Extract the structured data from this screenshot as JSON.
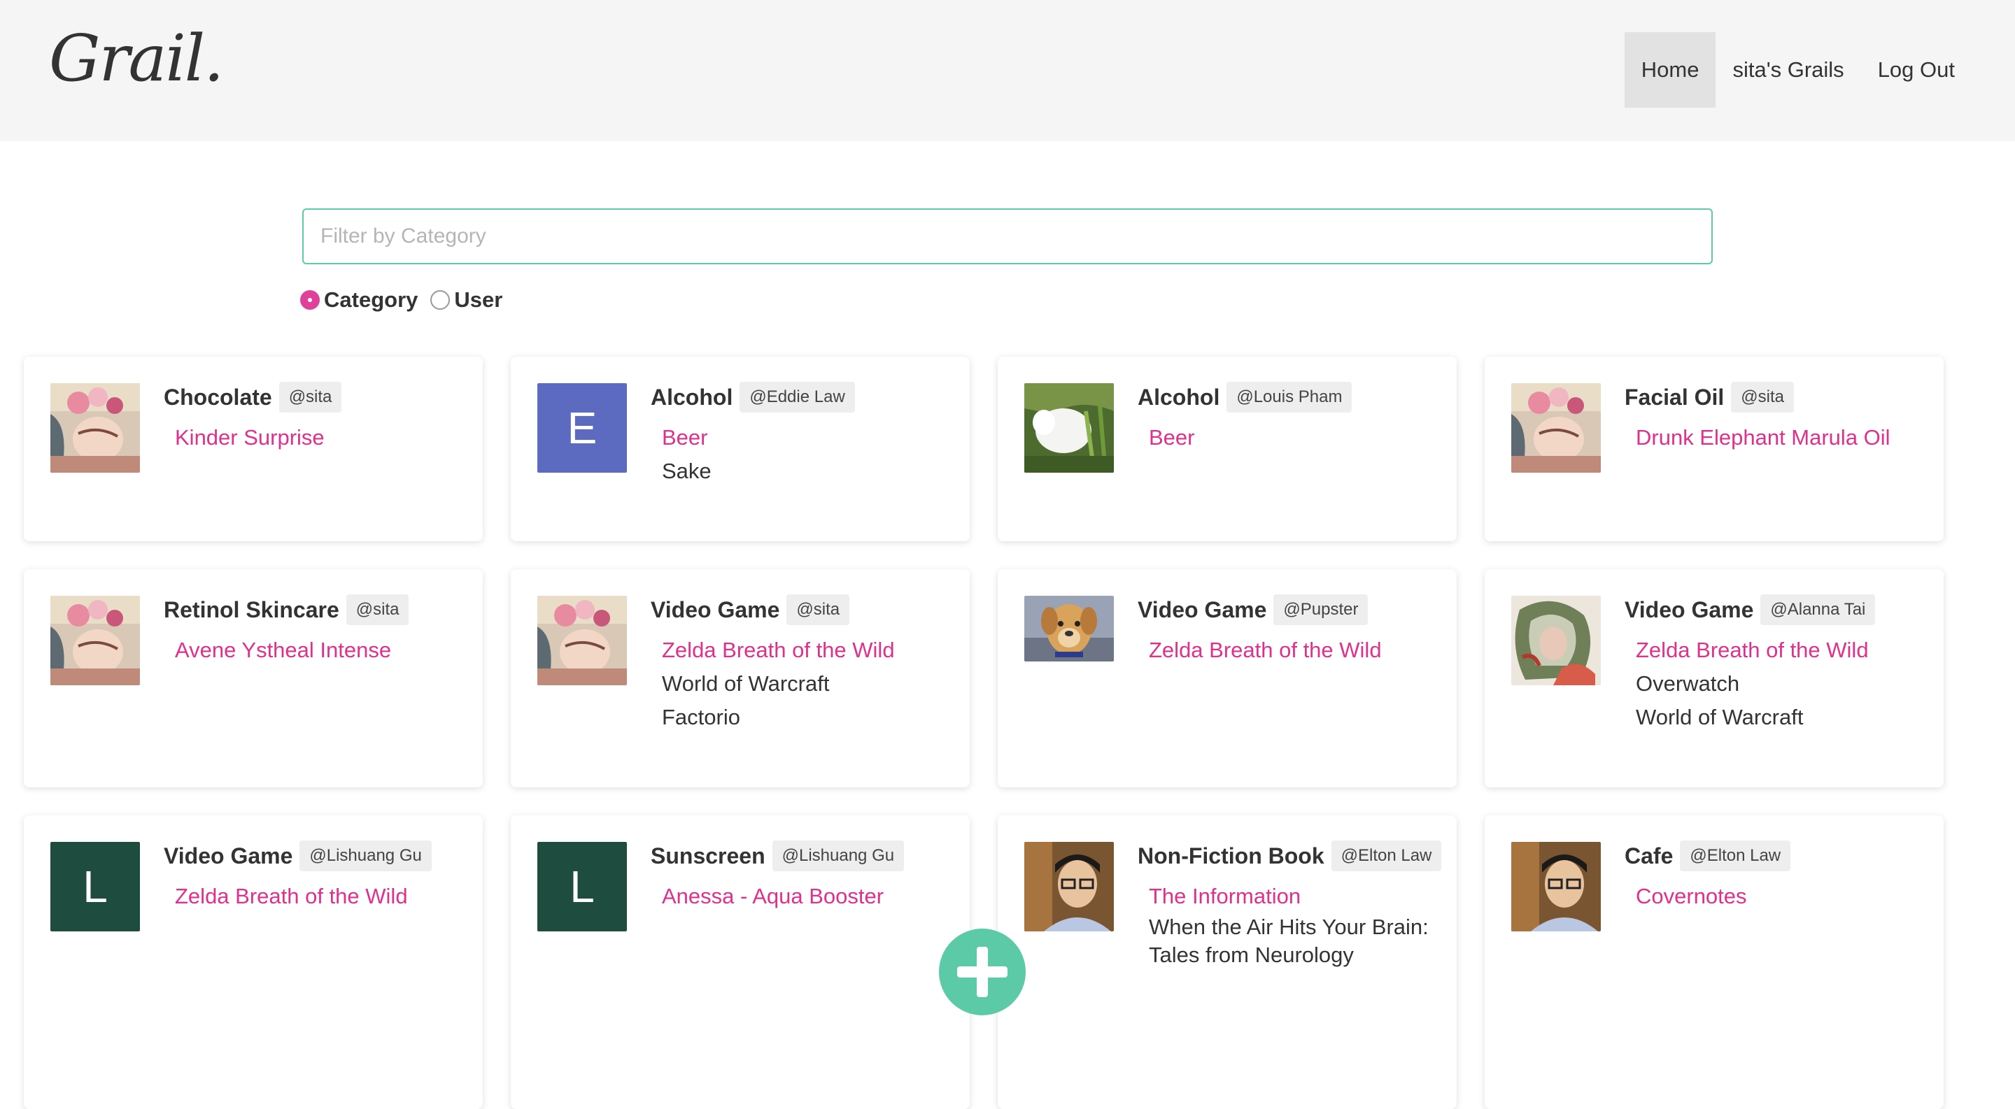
{
  "brand": {
    "logo_text": "Grail."
  },
  "nav": {
    "items": [
      "Home",
      "sita's Grails",
      "Log Out"
    ],
    "active": "Home"
  },
  "filter": {
    "placeholder": "Filter by Category",
    "value": ""
  },
  "search_mode": {
    "options": [
      "Category",
      "User"
    ],
    "selected": "Category"
  },
  "colors": {
    "accent_pink": "#e0308e",
    "accent_green": "#5cc9a7",
    "navbar_bg": "#f5f5f5"
  },
  "cards": [
    {
      "category": "Chocolate",
      "user": "@sita",
      "avatar": "image",
      "items": [
        "Kinder Surprise"
      ]
    },
    {
      "category": "Alcohol",
      "user": "@Eddie Law",
      "avatar": "E",
      "items": [
        "Beer",
        "Sake"
      ]
    },
    {
      "category": "Alcohol",
      "user": "@Louis Pham",
      "avatar": "image",
      "items": [
        "Beer"
      ]
    },
    {
      "category": "Facial Oil",
      "user": "@sita",
      "avatar": "image",
      "items": [
        "Drunk Elephant Marula Oil"
      ]
    },
    {
      "category": "Retinol Skincare",
      "user": "@sita",
      "avatar": "image",
      "items": [
        "Avene Ystheal Intense"
      ]
    },
    {
      "category": "Video Game",
      "user": "@sita",
      "avatar": "image",
      "items": [
        "Zelda Breath of the Wild",
        "World of Warcraft",
        "Factorio"
      ]
    },
    {
      "category": "Video Game",
      "user": "@Pupster",
      "avatar": "image",
      "items": [
        "Zelda Breath of the Wild"
      ]
    },
    {
      "category": "Video Game",
      "user": "@Alanna Tai",
      "avatar": "image",
      "items": [
        "Zelda Breath of the Wild",
        "Overwatch",
        "World of Warcraft"
      ]
    },
    {
      "category": "Video Game",
      "user": "@Lishuang Gu",
      "avatar": "L",
      "items": [
        "Zelda Breath of the Wild"
      ]
    },
    {
      "category": "Sunscreen",
      "user": "@Lishuang Gu",
      "avatar": "L",
      "items": [
        "Anessa - Aqua Booster"
      ]
    },
    {
      "category": "Non-Fiction Book",
      "user": "@Elton Law",
      "avatar": "image",
      "items": [
        "The Information",
        "When the Air Hits Your Brain: Tales from Neurology"
      ]
    },
    {
      "category": "Cafe",
      "user": "@Elton Law",
      "avatar": "image",
      "items": [
        "Covernotes"
      ]
    }
  ],
  "add_button": {
    "icon": "plus-icon"
  }
}
